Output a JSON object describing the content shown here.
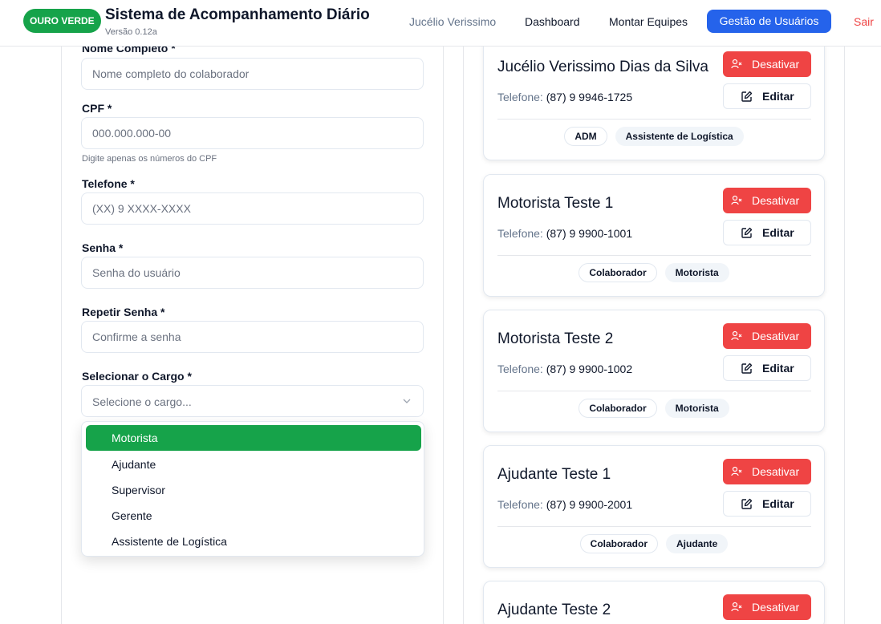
{
  "header": {
    "logo": "OURO VERDE",
    "title": "Sistema de Acompanhamento Diário",
    "version": "Versão 0.12a",
    "user": "Jucélio Verissimo",
    "nav": {
      "dashboard": "Dashboard",
      "teams": "Montar Equipes",
      "users": "Gestão de Usuários",
      "logout": "Sair"
    }
  },
  "form": {
    "name": {
      "label": "Nome Completo *",
      "placeholder": "Nome completo do colaborador",
      "value": ""
    },
    "cpf": {
      "label": "CPF *",
      "placeholder": "000.000.000-00",
      "value": "",
      "hint": "Digite apenas os números do CPF"
    },
    "phone": {
      "label": "Telefone *",
      "placeholder": "(XX) 9 XXXX-XXXX",
      "value": ""
    },
    "password": {
      "label": "Senha *",
      "placeholder": "Senha do usuário",
      "value": ""
    },
    "confirm": {
      "label": "Repetir Senha *",
      "placeholder": "Confirme a senha",
      "value": ""
    },
    "role": {
      "label": "Selecionar o Cargo *",
      "placeholder": "Selecione o cargo...",
      "options": [
        "Motorista",
        "Ajudante",
        "Supervisor",
        "Gerente",
        "Assistente de Logística"
      ],
      "highlighted": "Motorista"
    }
  },
  "users": [
    {
      "name": "Jucélio Verissimo Dias da Silva",
      "phone_label": "Telefone:",
      "phone": "(87) 9 9946-1725",
      "badges": [
        "ADM",
        "Assistente de Logística"
      ]
    },
    {
      "name": "Motorista Teste 1",
      "phone_label": "Telefone:",
      "phone": "(87) 9 9900-1001",
      "badges": [
        "Colaborador",
        "Motorista"
      ]
    },
    {
      "name": "Motorista Teste 2",
      "phone_label": "Telefone:",
      "phone": "(87) 9 9900-1002",
      "badges": [
        "Colaborador",
        "Motorista"
      ]
    },
    {
      "name": "Ajudante Teste 1",
      "phone_label": "Telefone:",
      "phone": "(87) 9 9900-2001",
      "badges": [
        "Colaborador",
        "Ajudante"
      ]
    },
    {
      "name": "Ajudante Teste 2",
      "phone_label": "",
      "phone": "",
      "badges": []
    }
  ],
  "actions": {
    "deactivate": "Desativar",
    "edit": "Editar"
  },
  "colors": {
    "brand": "#16a34a",
    "primary": "#2563eb",
    "danger": "#ef4444"
  }
}
